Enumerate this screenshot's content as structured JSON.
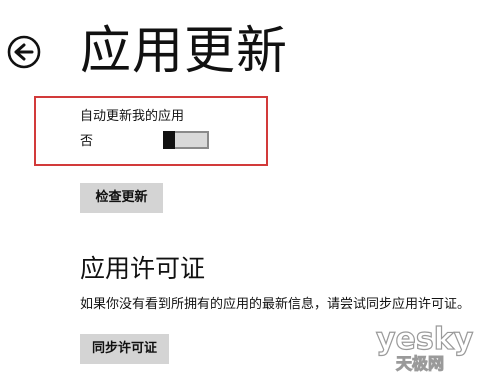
{
  "header": {
    "back_icon": "back-arrow-circle-icon",
    "title": "应用更新"
  },
  "auto_update": {
    "label": "自动更新我的应用",
    "toggle_state_text": "否",
    "toggle_on": false,
    "highlight_color": "#d23a3a"
  },
  "check_updates": {
    "button_label": "检查更新"
  },
  "license": {
    "section_title": "应用许可证",
    "description": "如果你没有看到所拥有的应用的最新信息，请尝试同步应用许可证。",
    "sync_button_label": "同步许可证"
  },
  "watermark": {
    "logo_text": "yesky",
    "subtitle": "天极网"
  }
}
